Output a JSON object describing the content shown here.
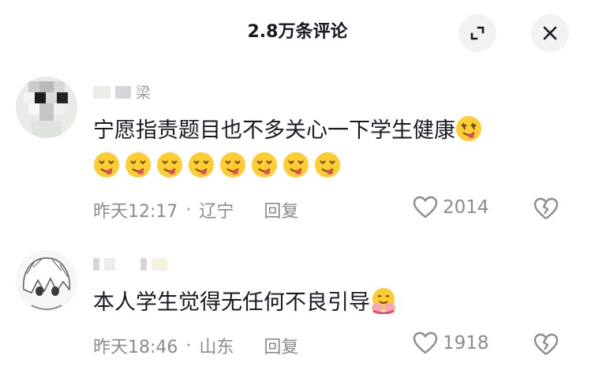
{
  "header": {
    "title": "2.8万条评论"
  },
  "comments": [
    {
      "username": "梁",
      "text": "宁愿指责题目也不多关心一下学生健康",
      "time": "昨天12:17",
      "dot": "·",
      "location": "辽宁",
      "reply_label": "回复",
      "likes": "2014"
    },
    {
      "username": "",
      "text": "本人学生觉得无任何不良引导",
      "time": "昨天18:46",
      "dot": "·",
      "location": "山东",
      "reply_label": "回复",
      "likes": "1918"
    }
  ],
  "icons": {
    "expand": "expand-icon",
    "close": "close-icon",
    "heart": "heart-outline-icon",
    "dislike": "broken-heart-icon",
    "emoji_1": "drooling-face-emoji",
    "emoji_2": "hugging-face-emoji"
  },
  "colors": {
    "text": "#161823",
    "muted": "#8a8b91",
    "button_bg": "#f2f2f4"
  }
}
